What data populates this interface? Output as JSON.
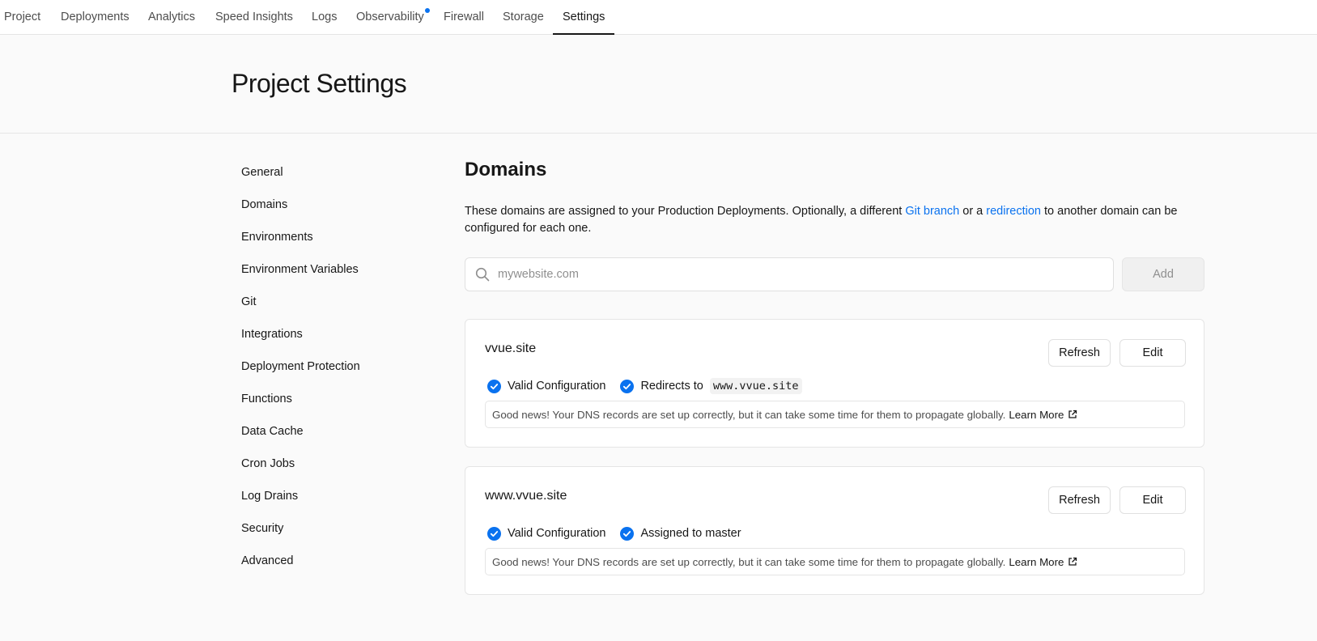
{
  "nav": {
    "tabs": [
      {
        "label": "Project"
      },
      {
        "label": "Deployments"
      },
      {
        "label": "Analytics"
      },
      {
        "label": "Speed Insights"
      },
      {
        "label": "Logs"
      },
      {
        "label": "Observability"
      },
      {
        "label": "Firewall"
      },
      {
        "label": "Storage"
      },
      {
        "label": "Settings"
      }
    ],
    "active": "Settings",
    "dot_color": "#0a72ef"
  },
  "header": {
    "title": "Project Settings"
  },
  "sidebar": {
    "items": [
      {
        "label": "General"
      },
      {
        "label": "Domains"
      },
      {
        "label": "Environments"
      },
      {
        "label": "Environment Variables"
      },
      {
        "label": "Git"
      },
      {
        "label": "Integrations"
      },
      {
        "label": "Deployment Protection"
      },
      {
        "label": "Functions"
      },
      {
        "label": "Data Cache"
      },
      {
        "label": "Cron Jobs"
      },
      {
        "label": "Log Drains"
      },
      {
        "label": "Security"
      },
      {
        "label": "Advanced"
      }
    ],
    "active": "Domains"
  },
  "domains": {
    "title": "Domains",
    "desc_part1": "These domains are assigned to your Production Deployments. Optionally, a different ",
    "desc_link1": "Git branch",
    "desc_part2": " or a ",
    "desc_link2": "redirection",
    "desc_part3": " to another domain can be configured for each one.",
    "search_placeholder": "mywebsite.com",
    "search_value": "",
    "add_label": "Add",
    "items": [
      {
        "name": "vvue.site",
        "refresh_label": "Refresh",
        "edit_label": "Edit",
        "status1": "Valid Configuration",
        "status2": "Redirects to",
        "status2_code": "www.vvue.site",
        "note": "Good news! Your DNS records are set up correctly, but it can take some time for them to propagate globally.",
        "learn_more": "Learn More"
      },
      {
        "name": "www.vvue.site",
        "refresh_label": "Refresh",
        "edit_label": "Edit",
        "status1": "Valid Configuration",
        "status2": "Assigned to master",
        "note": "Good news! Your DNS records are set up correctly, but it can take some time for them to propagate globally.",
        "learn_more": "Learn More"
      }
    ]
  },
  "colors": {
    "accent": "#0a72ef",
    "check": "#0a72ef",
    "background": "#fafafa",
    "border": "#e5e5e5"
  }
}
